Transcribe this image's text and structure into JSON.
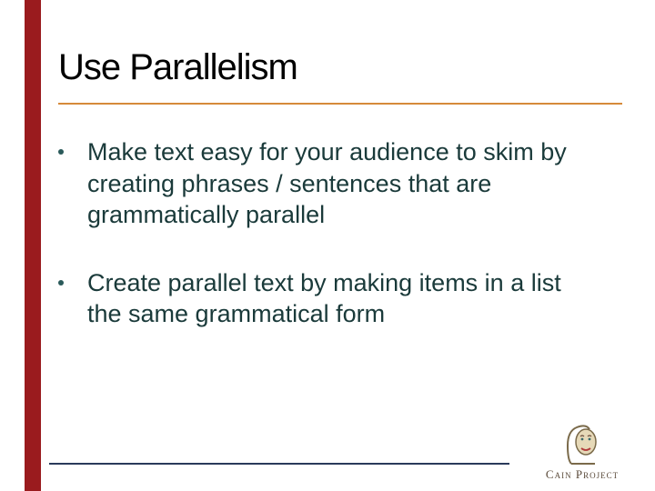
{
  "title": "Use Parallelism",
  "bullets": [
    "Make text easy for your audience to skim by creating phrases / sentences that are grammatically parallel",
    "Create parallel text by making items in a list the same grammatical form"
  ],
  "logo": {
    "name": "Cain Project"
  },
  "colors": {
    "accent_bar": "#9a1b1e",
    "title_rule": "#d68a3a",
    "bottom_rule": "#2a3a5a",
    "text": "#1a3a3a"
  }
}
